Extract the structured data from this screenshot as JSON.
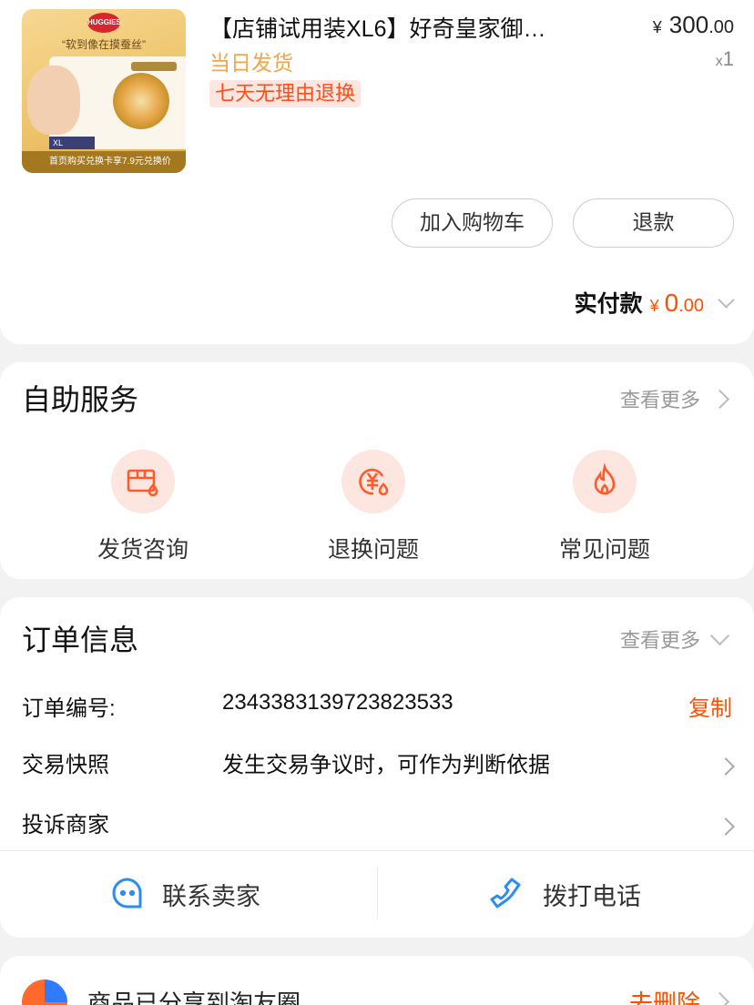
{
  "product": {
    "title": "【店铺试用装XL6】好奇皇家御…",
    "price_symbol": "¥",
    "price_int": "300",
    "price_dec": ".00",
    "qty_x": "x",
    "qty": "1",
    "shipping": "当日发货",
    "return_policy": "七天无理由退换",
    "image": {
      "brand": "HUGGIES",
      "slogan": "“软到像在摸蚕丝”",
      "size_tag": "XL",
      "strip_text": "首页购买兑换卡享7.9元兑换价"
    },
    "add_cart_label": "加入购物车",
    "refund_label": "退款",
    "paid_label": "实付款",
    "paid_symbol": "¥",
    "paid_int": "0",
    "paid_dec": ".00"
  },
  "self_service": {
    "title": "自助服务",
    "more": "查看更多",
    "items": [
      {
        "label": "发货咨询",
        "icon": "package-icon"
      },
      {
        "label": "退换问题",
        "icon": "yen-exchange-icon"
      },
      {
        "label": "常见问题",
        "icon": "flame-icon"
      }
    ]
  },
  "order_info": {
    "title": "订单信息",
    "more": "查看更多",
    "order_no_label": "订单编号:",
    "order_no": "2343383139723823533",
    "copy": "复制",
    "snapshot_label": "交易快照",
    "snapshot_value": "发生交易争议时，可作为判断依据",
    "complain_label": "投诉商家",
    "contact_seller": "联系卖家",
    "call_phone": "拨打电话"
  },
  "share": {
    "text": "商品已分享到淘友圈",
    "action": "去删除"
  },
  "colors": {
    "accent": "#ff5000",
    "shipping": "#f3a54a",
    "icon_bg": "#fde6df",
    "blue": "#2d8cf0"
  }
}
